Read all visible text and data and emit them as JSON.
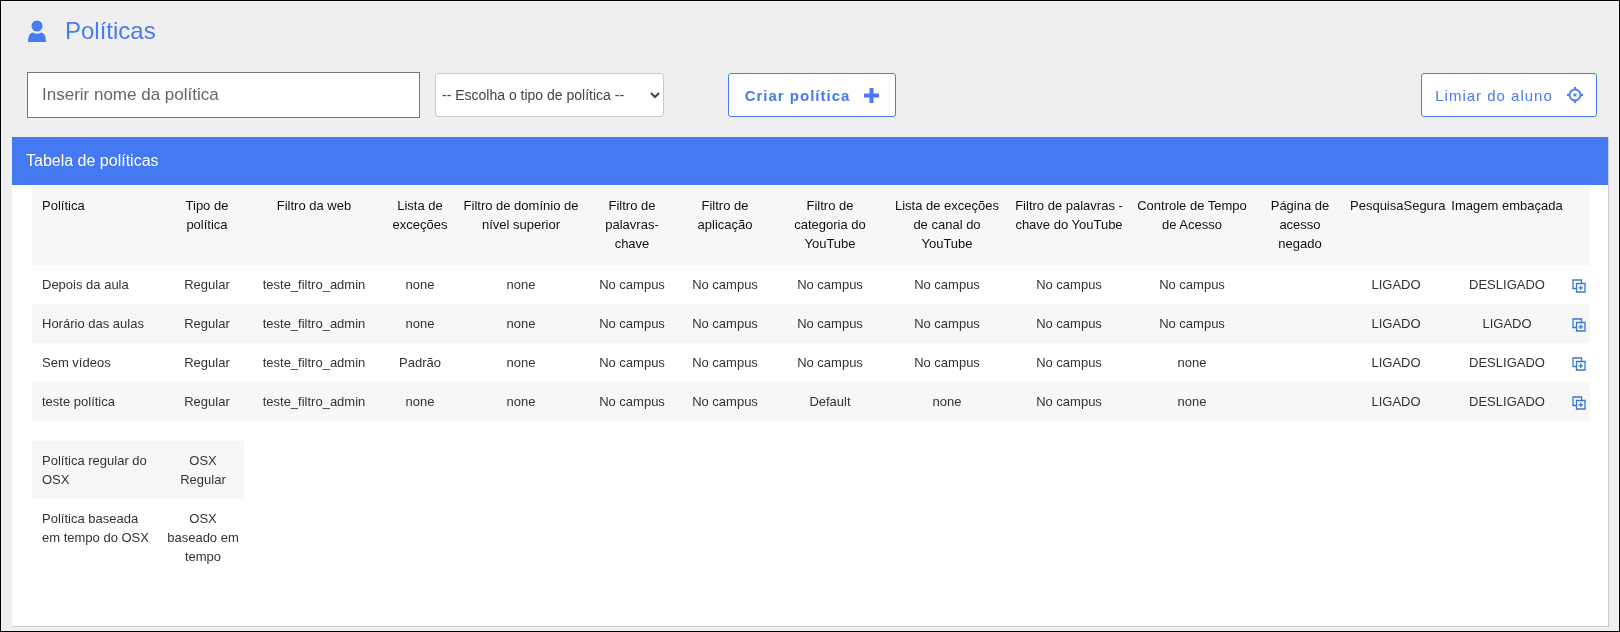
{
  "page": {
    "title": "Políticas"
  },
  "toolbar": {
    "name_field": {
      "placeholder": "Inserir nome da política"
    },
    "type_select": {
      "value": "-- Escolha o tipo de política --"
    },
    "create_button": {
      "label": "Criar política"
    },
    "threshold_button": {
      "label": "Limiar do aluno"
    }
  },
  "policy_table": {
    "title": "Tabela de políticas",
    "columns": [
      "Política",
      "Tipo de política",
      "Filtro da web",
      "Lista de exceções",
      "Filtro de domínio de nível superior",
      "Filtro de palavras-chave",
      "Filtro de aplicação",
      "Filtro de categoria do YouTube",
      "Lista de exceções de canal do YouTube",
      "Filtro de palavras -chave do YouTube",
      "Controle de Tempo de Acesso",
      "Página de acesso negado",
      "PesquisaSegura",
      "Imagem embaçada"
    ],
    "rows": [
      {
        "cells": [
          "Depois da aula",
          "Regular",
          "teste_filtro_admin",
          "none",
          "none",
          "No campus",
          "No campus",
          "No campus",
          "No campus",
          "No campus",
          "No campus",
          "",
          "LIGADO",
          "DESLIGADO"
        ]
      },
      {
        "cells": [
          "Horário das aulas",
          "Regular",
          "teste_filtro_admin",
          "none",
          "none",
          "No campus",
          "No campus",
          "No campus",
          "No campus",
          "No campus",
          "No campus",
          "",
          "LIGADO",
          "LIGADO"
        ]
      },
      {
        "cells": [
          "Sem vídeos",
          "Regular",
          "teste_filtro_admin",
          "Padrão",
          "none",
          "No campus",
          "No campus",
          "No campus",
          "No campus",
          "No campus",
          "none",
          "",
          "LIGADO",
          "DESLIGADO"
        ]
      },
      {
        "cells": [
          "teste política",
          "Regular",
          "teste_filtro_admin",
          "none",
          "none",
          "No campus",
          "No campus",
          "Default",
          "none",
          "No campus",
          "none",
          "",
          "LIGADO",
          "DESLIGADO"
        ]
      }
    ]
  },
  "osx_table": {
    "rows": [
      {
        "cells": [
          "Política regular do OSX",
          "OSX Regular"
        ]
      },
      {
        "cells": [
          "Política baseada em tempo do OSX",
          "OSX baseado em tempo"
        ]
      }
    ]
  }
}
